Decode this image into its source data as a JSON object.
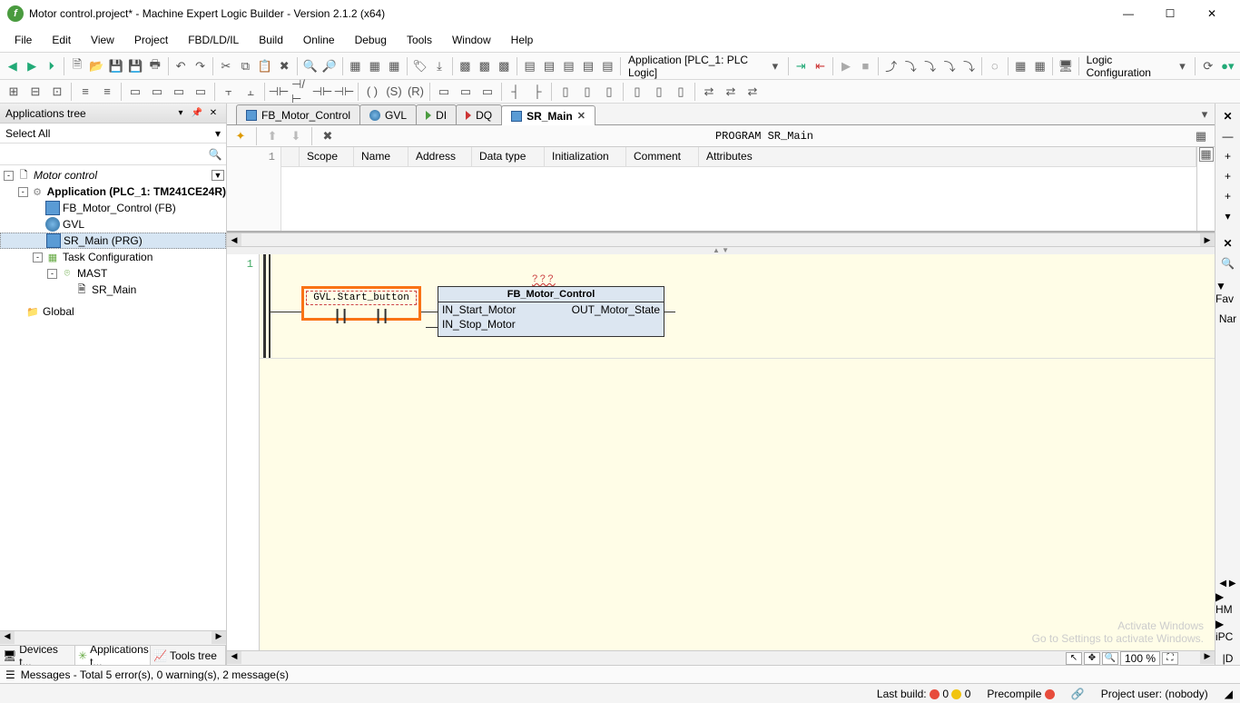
{
  "window": {
    "title": "Motor control.project* - Machine Expert Logic Builder - Version 2.1.2 (x64)"
  },
  "menu": [
    "File",
    "Edit",
    "View",
    "Project",
    "FBD/LD/IL",
    "Build",
    "Online",
    "Debug",
    "Tools",
    "Window",
    "Help"
  ],
  "context_combo": "Application [PLC_1: PLC Logic]",
  "logic_combo": "Logic Configuration",
  "apptree": {
    "title": "Applications tree",
    "select_all": "Select All",
    "nodes": {
      "root": "Motor control",
      "app": "Application (PLC_1: TM241CE24R)",
      "fb": "FB_Motor_Control (FB)",
      "gvl": "GVL",
      "sr": "SR_Main (PRG)",
      "task": "Task Configuration",
      "mast": "MAST",
      "sr2": "SR_Main",
      "global": "Global"
    }
  },
  "bottom_tabs": {
    "devices": "Devices t...",
    "apps": "Applications t...",
    "tools": "Tools tree"
  },
  "editor_tabs": [
    {
      "label": "FB_Motor_Control",
      "icon": "fb"
    },
    {
      "label": "GVL",
      "icon": "gvl"
    },
    {
      "label": "DI",
      "icon": "arrow"
    },
    {
      "label": "DQ",
      "icon": "arrow"
    },
    {
      "label": "SR_Main",
      "icon": "fb",
      "active": true,
      "closable": true
    }
  ],
  "program_header": "PROGRAM SR_Main",
  "var_margin": "1",
  "var_cols": [
    "Scope",
    "Name",
    "Address",
    "Data type",
    "Initialization",
    "Comment",
    "Attributes"
  ],
  "ladder": {
    "rung_no": "1",
    "qmarks": "???",
    "contact_label": "GVL.Start_button",
    "fb_title": "FB_Motor_Control",
    "fb_in1": "IN_Start_Motor",
    "fb_in2": "IN_Stop_Motor",
    "fb_out1": "OUT_Motor_State"
  },
  "zoom": "100 %",
  "messages": "Messages - Total 5 error(s), 0 warning(s), 2 message(s)",
  "status": {
    "lastbuild": "Last build:",
    "e": "0",
    "w": "0",
    "precompile": "Precompile",
    "user": "Project user: (nobody)"
  },
  "right_tabs": {
    "fav": "▼ Fav",
    "nar": "Nar",
    "hm": "▶ HM",
    "ipc": "▶ iPC",
    "d": "|D"
  },
  "watermark": {
    "l1": "Activate Windows",
    "l2": "Go to Settings to activate Windows."
  }
}
